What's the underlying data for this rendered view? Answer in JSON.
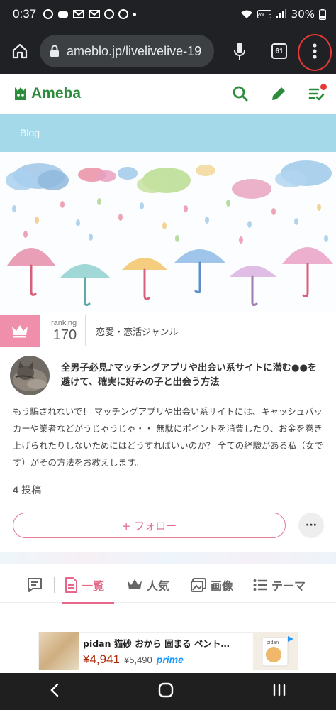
{
  "status_bar": {
    "time": "0:37",
    "battery": "30%",
    "notification_icons": [
      "alarm-icon",
      "pet-icon",
      "gmail-icon",
      "gmail-icon",
      "app-icon",
      "app-icon"
    ]
  },
  "browser": {
    "url": "ameblo.jp/livelivelive-19",
    "tab_count": "61"
  },
  "ameba": {
    "logo_text": "Ameba"
  },
  "blog_label": "Blog",
  "ranking": {
    "label": "ranking",
    "value": "170",
    "genre": "恋愛・恋活ジャンル"
  },
  "profile": {
    "title": "全男子必見♪マッチングアプリや出会い系サイトに潜む●●を避けて、確実に好みの子と出会う方法"
  },
  "description": "もう騙されないで！ マッチングアプリや出会い系サイトには、キャッシュバッカーや業者などがうじゃうじゃ・・ 無駄にポイントを消費したり、お金を巻き上げられたりしないためにはどうすればいいのか？ 全ての経験がある私（女です）がその方法をお教えします。",
  "posts": {
    "count": "4",
    "label": "投稿"
  },
  "follow": {
    "label": "+ フォロー",
    "more": "···"
  },
  "tabs": [
    {
      "label": "一覧",
      "active": true
    },
    {
      "label": "人気",
      "active": false
    },
    {
      "label": "画像",
      "active": false
    },
    {
      "label": "テーマ",
      "active": false
    }
  ],
  "ad": {
    "title": "pidan 猫砂 おから 固まる ベント…",
    "price": "¥4,941",
    "old_price": "¥5,490",
    "prime": "prime",
    "thumb_brand": "pidan"
  },
  "colors": {
    "ameba_green": "#2d8c3c",
    "pink_accent": "#e5688a",
    "blog_band": "#a4d9ea",
    "browser_dark": "#202124"
  }
}
